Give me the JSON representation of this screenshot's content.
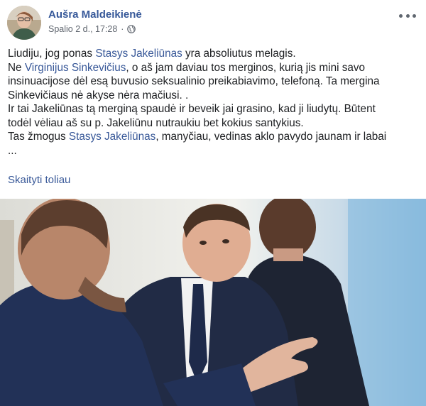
{
  "post": {
    "author": "Aušra Maldeikienė",
    "date": "Spalio 2 d., 17:28",
    "separator": "·",
    "lines": [
      [
        {
          "t": "Liudiju, jog ponas ",
          "link": false
        },
        {
          "t": "Stasys Jakeliūnas",
          "link": true
        },
        {
          "t": " yra absoliutus melagis.",
          "link": false
        }
      ],
      [
        {
          "t": "Ne ",
          "link": false
        },
        {
          "t": "Virginijus Sinkevičius",
          "link": true
        },
        {
          "t": ", o aš jam daviau tos merginos, kurią jis mini savo",
          "link": false
        }
      ],
      [
        {
          "t": "insinuacijose dėl esą buvusio seksualinio preikabiavimo, telefoną. Ta mergina",
          "link": false
        }
      ],
      [
        {
          "t": "Sinkevičiaus nė akyse nėra mačiusi. .",
          "link": false
        }
      ],
      [
        {
          "t": "Ir tai Jakeliūnas tą merginą spaudė ir beveik jai grasino, kad ji liudytų. Būtent",
          "link": false
        }
      ],
      [
        {
          "t": "todėl vėliau aš su p. Jakeliūnu nutraukiu bet kokius santykius.",
          "link": false
        }
      ],
      [
        {
          "t": "Tas žmogus ",
          "link": false
        },
        {
          "t": "Stasys Jakeliūnas",
          "link": true
        },
        {
          "t": ", manyčiau, vedinas aklo pavydo jaunam ir labai",
          "link": false
        }
      ],
      [
        {
          "t": "...",
          "link": false
        }
      ]
    ],
    "see_more": "Skaityti toliau"
  }
}
